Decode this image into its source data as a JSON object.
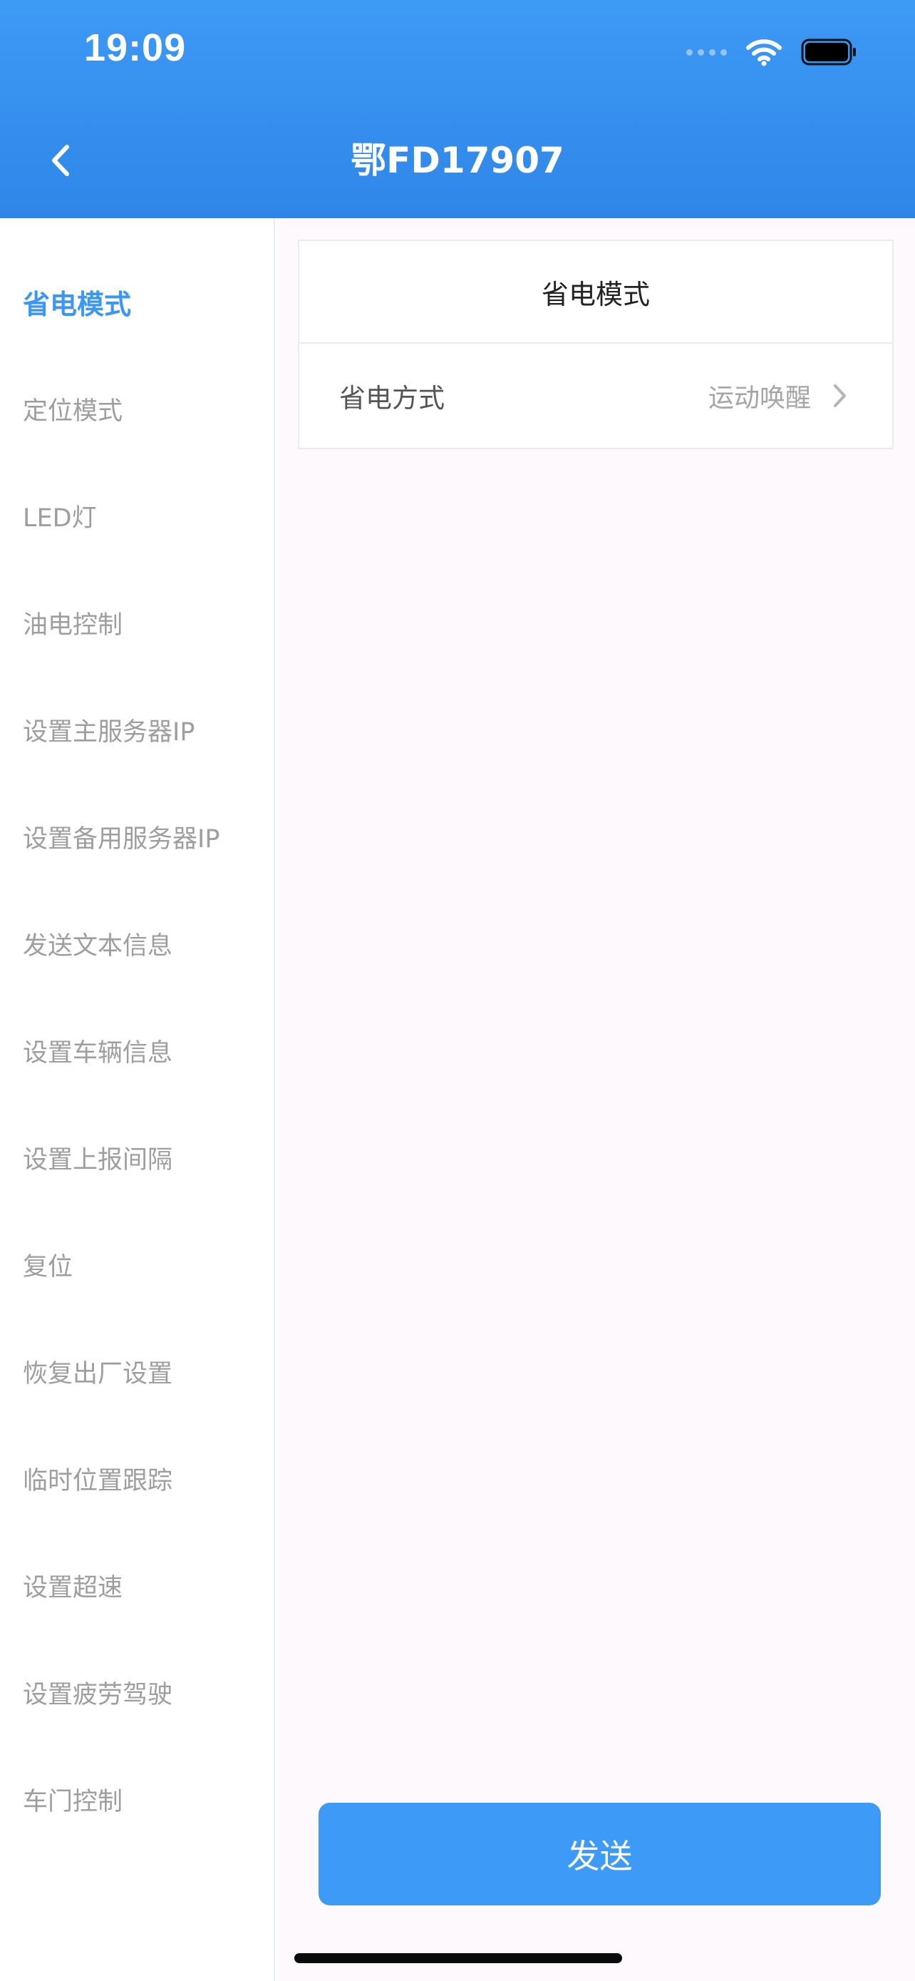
{
  "status_bar": {
    "time": "19:09"
  },
  "header": {
    "title": "鄂FD17907"
  },
  "sidebar": {
    "items": [
      {
        "label": "省电模式",
        "active": true
      },
      {
        "label": "定位模式"
      },
      {
        "label": "LED灯"
      },
      {
        "label": "油电控制"
      },
      {
        "label": "设置主服务器IP"
      },
      {
        "label": "设置备用服务器IP"
      },
      {
        "label": "发送文本信息"
      },
      {
        "label": "设置车辆信息"
      },
      {
        "label": "设置上报间隔"
      },
      {
        "label": "复位"
      },
      {
        "label": "恢复出厂设置"
      },
      {
        "label": "临时位置跟踪"
      },
      {
        "label": "设置超速"
      },
      {
        "label": "设置疲劳驾驶"
      },
      {
        "label": "车门控制"
      }
    ]
  },
  "card": {
    "title": "省电模式",
    "row_label": "省电方式",
    "row_value": "运动唤醒"
  },
  "actions": {
    "send_label": "发送"
  },
  "colors": {
    "header_bg": "#3d9af5",
    "accent": "#3b97f3",
    "button_bg": "#3d9bf7"
  }
}
